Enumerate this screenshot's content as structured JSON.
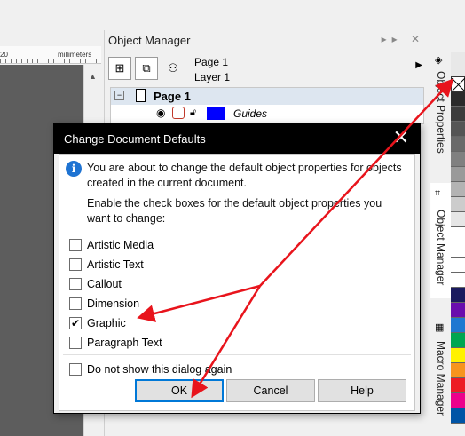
{
  "ruler": {
    "tick_label": "20",
    "units_label": "millimeters"
  },
  "docker": {
    "title": "Object Manager",
    "controls": "▸▸ ✕",
    "page_name": "Page 1",
    "layer_name": "Layer 1",
    "tree": {
      "page_label": "Page 1",
      "layer_label": "Guides"
    }
  },
  "vertical_tabs": {
    "object_properties": "Object Properties",
    "object_manager": "Object Manager",
    "macro_manager": "Macro Manager"
  },
  "palette": {
    "colors": [
      "#ffffff",
      "#2b2b2b",
      "#3d3d3d",
      "#555555",
      "#6a6a6a",
      "#808080",
      "#9a9a9a",
      "#b3b3b3",
      "#cccccc",
      "#e6e6e6",
      "#ffffff",
      "#ffffff",
      "#ffffff",
      "#ffffff",
      "#1a1a5e",
      "#6a0dad",
      "#1f78d1",
      "#00a651",
      "#fff200",
      "#f7941d",
      "#ed1c24",
      "#ec008c",
      "#0054a6"
    ]
  },
  "dialog": {
    "title": "Change Document Defaults",
    "close_glyph": "✕",
    "message1": "You are about to change the default object properties for objects created in the current document.",
    "message2": "Enable the check boxes for the default object properties you want to change:",
    "options": [
      {
        "label": "Artistic Media",
        "checked": false
      },
      {
        "label": "Artistic Text",
        "checked": false
      },
      {
        "label": "Callout",
        "checked": false
      },
      {
        "label": "Dimension",
        "checked": false
      },
      {
        "label": "Graphic",
        "checked": true
      },
      {
        "label": "Paragraph Text",
        "checked": false
      }
    ],
    "dont_show_label": "Do not show this dialog again",
    "dont_show_checked": false,
    "ok_label": "OK",
    "cancel_label": "Cancel",
    "help_label": "Help"
  },
  "colors": {
    "annotation_arrow": "#e8141c",
    "dialog_title_bg": "#000000",
    "ok_border": "#0078d7"
  }
}
